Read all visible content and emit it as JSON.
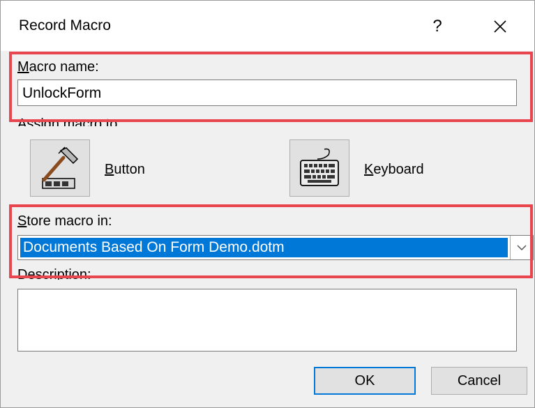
{
  "dialog": {
    "title": "Record Macro",
    "help_label": "?"
  },
  "macro_name": {
    "label_accel": "M",
    "label_rest": "acro name:",
    "value": "UnlockForm"
  },
  "assign": {
    "label": "Assign macro to",
    "button_accel": "B",
    "button_rest": "utton",
    "keyboard_accel": "K",
    "keyboard_rest": "eyboard"
  },
  "store": {
    "label_accel": "S",
    "label_rest": "tore macro in:",
    "selected": "Documents Based On Form Demo.dotm"
  },
  "description": {
    "label_accel": "D",
    "label_rest": "escription:",
    "value": ""
  },
  "buttons": {
    "ok": "OK",
    "cancel": "Cancel"
  },
  "colors": {
    "highlight": "#e8454f",
    "selection": "#0078d7"
  },
  "icons": [
    "hammer-icon",
    "keyboard-icon",
    "chevron-down-icon",
    "close-icon"
  ]
}
